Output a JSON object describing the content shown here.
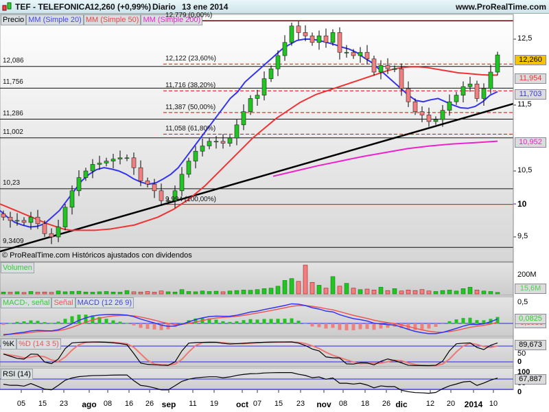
{
  "header": {
    "symbol": "TEF - TELEFONICA",
    "quote": "12,260 (+0,99%)",
    "period": "Diario",
    "date": "13 ene 2014",
    "site": "www.ProRealTime.com"
  },
  "legends": {
    "price": "Precio",
    "ma20": "MM (Simple 20)",
    "ma50": "MM (Simple 50)",
    "ma200": "MM (Simple 200)",
    "volume": "Volumen",
    "macd_hist": "MACD-, señal",
    "macd_signal": "Señal",
    "macd": "MACD (12 26 9)",
    "stoch_k": "%K",
    "stoch_d": "%D (14 3 5)",
    "rsi": "RSI (14)"
  },
  "copyright": "© ProRealTime.com  Históricos ajustados con dividendos",
  "colors": {
    "up": "#22c322",
    "down": "#f08080",
    "ma20": "#3333ee",
    "ma50": "#ee3333",
    "ma200": "#ee22cc",
    "last": "#f5c400"
  },
  "chart_data": {
    "type": "candlestick",
    "title": "TEF - TELEFONICA Diario",
    "close": [
      9.8,
      9.75,
      9.75,
      9.72,
      9.8,
      9.7,
      9.55,
      9.5,
      9.65,
      9.95,
      10.2,
      10.4,
      10.5,
      10.6,
      10.62,
      10.65,
      10.68,
      10.7,
      10.7,
      10.55,
      10.35,
      10.3,
      10.2,
      10.05,
      10.05,
      10.2,
      10.45,
      10.65,
      10.8,
      10.88,
      10.95,
      10.95,
      10.92,
      11.0,
      11.2,
      11.4,
      11.6,
      11.65,
      11.9,
      12.05,
      12.25,
      12.45,
      12.7,
      12.6,
      12.55,
      12.45,
      12.55,
      12.45,
      12.6,
      12.3,
      12.3,
      12.25,
      12.3,
      12.2,
      12.0,
      12.1,
      12.05,
      12.05,
      11.75,
      11.55,
      11.4,
      11.35,
      11.25,
      11.28,
      11.42,
      11.55,
      11.65,
      11.78,
      11.82,
      11.6,
      11.75,
      12.0,
      12.26
    ],
    "volume_millions": [
      20,
      18,
      22,
      15,
      25,
      18,
      20,
      16,
      30,
      22,
      25,
      28,
      20,
      18,
      22,
      25,
      20,
      18,
      35,
      22,
      20,
      25,
      18,
      30,
      22,
      20,
      45,
      25,
      22,
      30,
      25,
      28,
      22,
      30,
      35,
      40,
      38,
      45,
      55,
      60,
      80,
      140,
      160,
      130,
      300,
      120,
      90,
      60,
      180,
      80,
      110,
      60,
      45,
      50,
      40,
      70,
      35,
      55,
      30,
      40,
      35,
      45,
      30,
      25,
      35,
      40,
      30,
      55,
      70,
      40,
      30,
      25,
      15.6
    ],
    "ma20": [
      9.9,
      9.8,
      9.72,
      9.68,
      9.65,
      9.66,
      9.7,
      9.8,
      9.9,
      10.05,
      10.2,
      10.35,
      10.45,
      10.52,
      10.55,
      10.53,
      10.5,
      10.45,
      10.38,
      10.33,
      10.3,
      10.32,
      10.38,
      10.45,
      10.55,
      10.7,
      10.85,
      11.0,
      11.15,
      11.3,
      11.45,
      11.6,
      11.7,
      11.85,
      11.95,
      12.05,
      12.15,
      12.25,
      12.35,
      12.42,
      12.48,
      12.5,
      12.5,
      12.48,
      12.45,
      12.42,
      12.38,
      12.35,
      12.3,
      12.22,
      12.15,
      12.05,
      11.95,
      11.85,
      11.75,
      11.65,
      11.57,
      11.55,
      11.58,
      11.6,
      11.55,
      11.5,
      11.46,
      11.45,
      11.48,
      11.55,
      11.65,
      11.703
    ],
    "ma50": [
      10.0,
      9.95,
      9.9,
      9.85,
      9.8,
      9.75,
      9.7,
      9.66,
      9.62,
      9.6,
      9.6,
      9.6,
      9.6,
      9.61,
      9.62,
      9.64,
      9.66,
      9.68,
      9.72,
      9.76,
      9.8,
      9.86,
      9.92,
      10.0,
      10.08,
      10.18,
      10.28,
      10.4,
      10.52,
      10.64,
      10.76,
      10.88,
      11.0,
      11.1,
      11.2,
      11.3,
      11.38,
      11.46,
      11.54,
      11.6,
      11.66,
      11.7,
      11.74,
      11.78,
      11.82,
      11.86,
      11.9,
      11.94,
      11.98,
      12.02,
      12.05,
      12.07,
      12.08,
      12.08,
      12.07,
      12.05,
      12.03,
      12.01,
      11.99,
      11.98,
      11.97,
      11.96,
      11.955,
      11.954
    ],
    "ma200": [
      10.42,
      10.5,
      10.58,
      10.65,
      10.72,
      10.78,
      10.84,
      10.88,
      10.91,
      10.93,
      10.952
    ],
    "trendline": [
      9.28,
      11.52
    ],
    "support_levels": [
      {
        "value": 12.086,
        "label": "12,086"
      },
      {
        "value": 11.756,
        "label": "11,756"
      },
      {
        "value": 11.286,
        "label": "11,286"
      },
      {
        "value": 11.002,
        "label": "11,002"
      },
      {
        "value": 10.23,
        "label": "10,23"
      },
      {
        "value": 9.3409,
        "label": "9,3409"
      }
    ],
    "fibonacci": [
      {
        "value": 12.779,
        "label": "12,779 (0,00%)"
      },
      {
        "value": 12.122,
        "label": "12,122 (23,60%)"
      },
      {
        "value": 11.716,
        "label": "11,716 (38,20%)"
      },
      {
        "value": 11.387,
        "label": "11,387 (50,00%)"
      },
      {
        "value": 11.058,
        "label": "11,058 (61,80%)"
      },
      {
        "value": 9.994,
        "label": "9,994 (100,00%)"
      }
    ],
    "y_ticks": [
      {
        "v": 12.5,
        "l": "12,5"
      },
      {
        "v": 11.5,
        "l": "11,5"
      },
      {
        "v": 10.5,
        "l": "10,5"
      },
      {
        "v": 10,
        "l": "10"
      },
      {
        "v": 9.5,
        "l": "9,5"
      }
    ],
    "x_ticks": [
      {
        "l": "05",
        "b": false,
        "i": 2.6
      },
      {
        "l": "15",
        "b": false,
        "i": 5.7
      },
      {
        "l": "23",
        "b": false,
        "i": 8.8
      },
      {
        "l": "ago",
        "b": true,
        "i": 12.5
      },
      {
        "l": "08",
        "b": false,
        "i": 15.2
      },
      {
        "l": "16",
        "b": false,
        "i": 18.3
      },
      {
        "l": "26",
        "b": false,
        "i": 21.3
      },
      {
        "l": "sep",
        "b": true,
        "i": 24.1
      },
      {
        "l": "11",
        "b": false,
        "i": 27.6
      },
      {
        "l": "19",
        "b": false,
        "i": 30.7
      },
      {
        "l": "oct",
        "b": true,
        "i": 34.8
      },
      {
        "l": "07",
        "b": false,
        "i": 37
      },
      {
        "l": "15",
        "b": false,
        "i": 40.1
      },
      {
        "l": "23",
        "b": false,
        "i": 43.3
      },
      {
        "l": "nov",
        "b": true,
        "i": 46.7
      },
      {
        "l": "08",
        "b": false,
        "i": 49.5
      },
      {
        "l": "18",
        "b": false,
        "i": 52.7
      },
      {
        "l": "26",
        "b": false,
        "i": 55.8
      },
      {
        "l": "dic",
        "b": true,
        "i": 58
      },
      {
        "l": "12",
        "b": false,
        "i": 62.2
      },
      {
        "l": "20",
        "b": false,
        "i": 65.2
      },
      {
        "l": "2014",
        "b": true,
        "i": 68.5
      },
      {
        "l": "10",
        "b": false,
        "i": 71.4
      }
    ],
    "last_values": {
      "price": "12,260",
      "ma50": "11,954",
      "ma20": "11,703",
      "ma200": "10,952",
      "volume": "15,6M",
      "macd": "0,0825",
      "signal": "-0,0030",
      "stoch": "89,673",
      "rsi": "67,887"
    },
    "indicator_ticks": {
      "volume": "200M",
      "macd": "0,5",
      "stoch_50": "50",
      "stoch_0": "0",
      "rsi_100": "100",
      "rsi_50": "50",
      "rsi_0": "0"
    }
  }
}
